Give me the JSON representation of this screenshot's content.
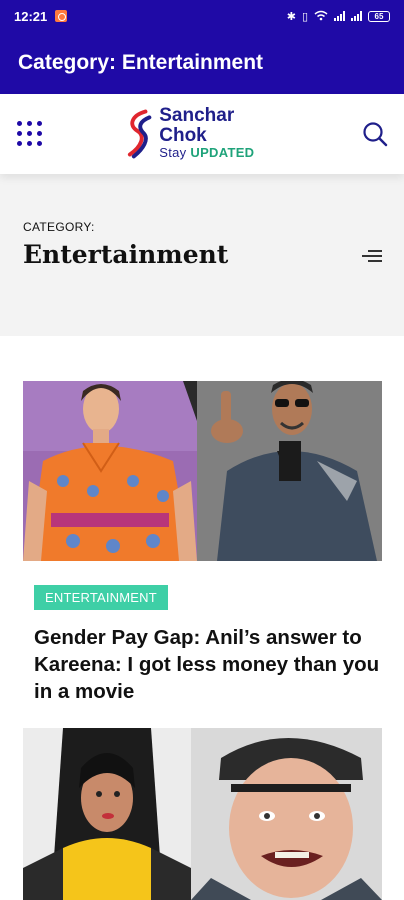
{
  "status_bar": {
    "time": "12:21",
    "battery": "65"
  },
  "app_bar": {
    "title": "Category: Entertainment"
  },
  "site_header": {
    "logo_name": "Sanchar Chok",
    "logo_tag_prefix": "Stay",
    "logo_tag_highlight": "UPDATED",
    "menu_icon": "grid-dots-icon",
    "search_icon": "search-icon"
  },
  "category": {
    "label": "CATEGORY:",
    "title": "Entertainment"
  },
  "articles": [
    {
      "badge": "ENTERTAINMENT",
      "headline": "Gender Pay Gap: Anil’s answer to Kareena: I got less money than you in a movie"
    },
    {
      "badge": "",
      "headline": ""
    }
  ],
  "colors": {
    "primary": "#1f0aa6",
    "badge": "#3ecfa6",
    "category_bg": "#f3f3f3"
  }
}
